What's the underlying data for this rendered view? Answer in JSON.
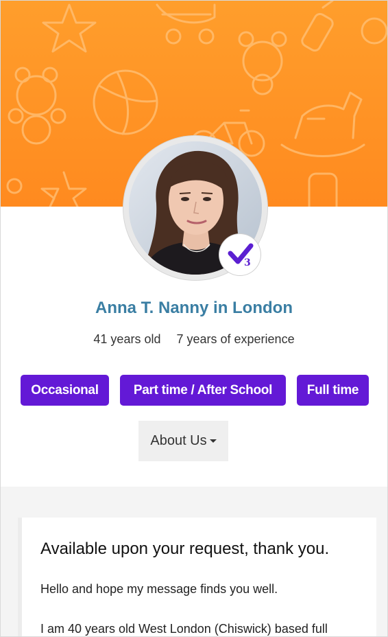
{
  "profile": {
    "name": "Anna T. Nanny in London",
    "age": "41 years old",
    "experience": "7 years of experience",
    "verification_count": "3"
  },
  "tags": [
    "Occasional",
    "Part time / After School",
    "Full time"
  ],
  "about_button": {
    "label": "About Us"
  },
  "about_card": {
    "title": "Available upon your request, thank you.",
    "paragraph1": "Hello and hope my message finds you well.",
    "paragraph2": "I am 40 years old West London (Chiswick) based full"
  },
  "colors": {
    "banner": "#ff8f22",
    "accent": "#6319d6",
    "name": "#3a7ea3"
  },
  "icons": [
    "star-icon",
    "stroller-icon",
    "bottle-icon",
    "teddy-bear-icon",
    "ball-icon",
    "bicycle-icon",
    "rocking-horse-icon",
    "verified-check-icon",
    "caret-down-icon"
  ]
}
